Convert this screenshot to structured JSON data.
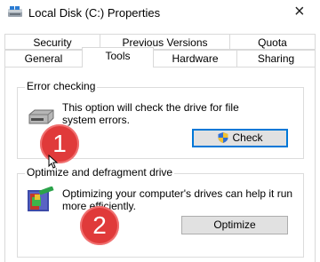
{
  "window": {
    "title": "Local Disk (C:) Properties",
    "close_glyph": "×"
  },
  "tabs_row1": [
    {
      "label": "Security"
    },
    {
      "label": "Previous Versions"
    },
    {
      "label": "Quota"
    }
  ],
  "tabs_row2": [
    {
      "label": "General"
    },
    {
      "label": "Tools",
      "active": true
    },
    {
      "label": "Hardware"
    },
    {
      "label": "Sharing"
    }
  ],
  "error_checking": {
    "title": "Error checking",
    "description": "This option will check the drive for file system errors.",
    "button_label": "Check"
  },
  "optimize": {
    "title": "Optimize and defragment drive",
    "description": "Optimizing your computer's drives can help it run more efficiently.",
    "button_label": "Optimize"
  },
  "annotations": [
    {
      "number": "1"
    },
    {
      "number": "2"
    }
  ],
  "colors": {
    "badge": "#e03a3a",
    "accent": "#0078d7"
  }
}
